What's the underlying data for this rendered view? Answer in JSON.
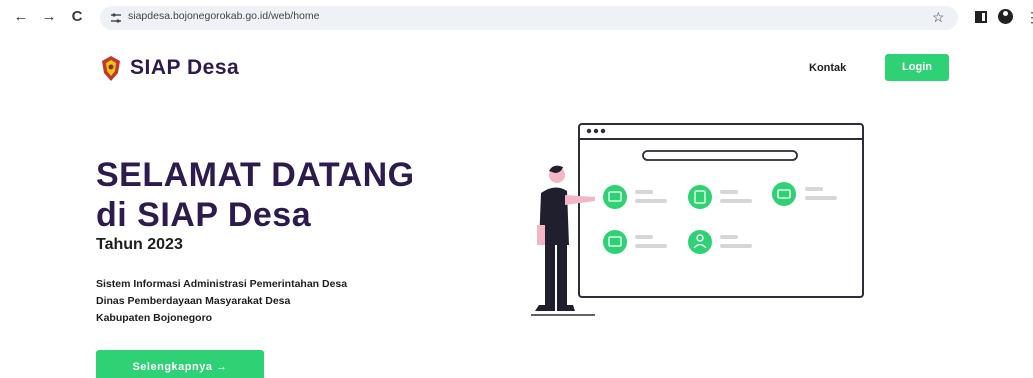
{
  "browser": {
    "url": "siapdesa.bojonegorokab.go.id/web/home",
    "back_icon": "←",
    "forward_icon": "→",
    "reload_icon": "C",
    "star_icon": "☆",
    "more_icon": "⋮"
  },
  "header": {
    "brand": "SIAP Desa",
    "nav_contact": "Kontak",
    "login_label": "Login"
  },
  "hero": {
    "title_line1": "SELAMAT DATANG",
    "title_line2": "di SIAP Desa",
    "year": "Tahun 2023",
    "desc_line1": "Sistem Informasi Administrasi Pemerintahan Desa",
    "desc_line2": "Dinas Pemberdayaan Masyarakat Desa",
    "desc_line3": "Kabupaten Bojonegoro",
    "cta_label": "Selengkapnya →"
  },
  "colors": {
    "brand_dark": "#2d1b4e",
    "accent_green": "#2fd175"
  }
}
